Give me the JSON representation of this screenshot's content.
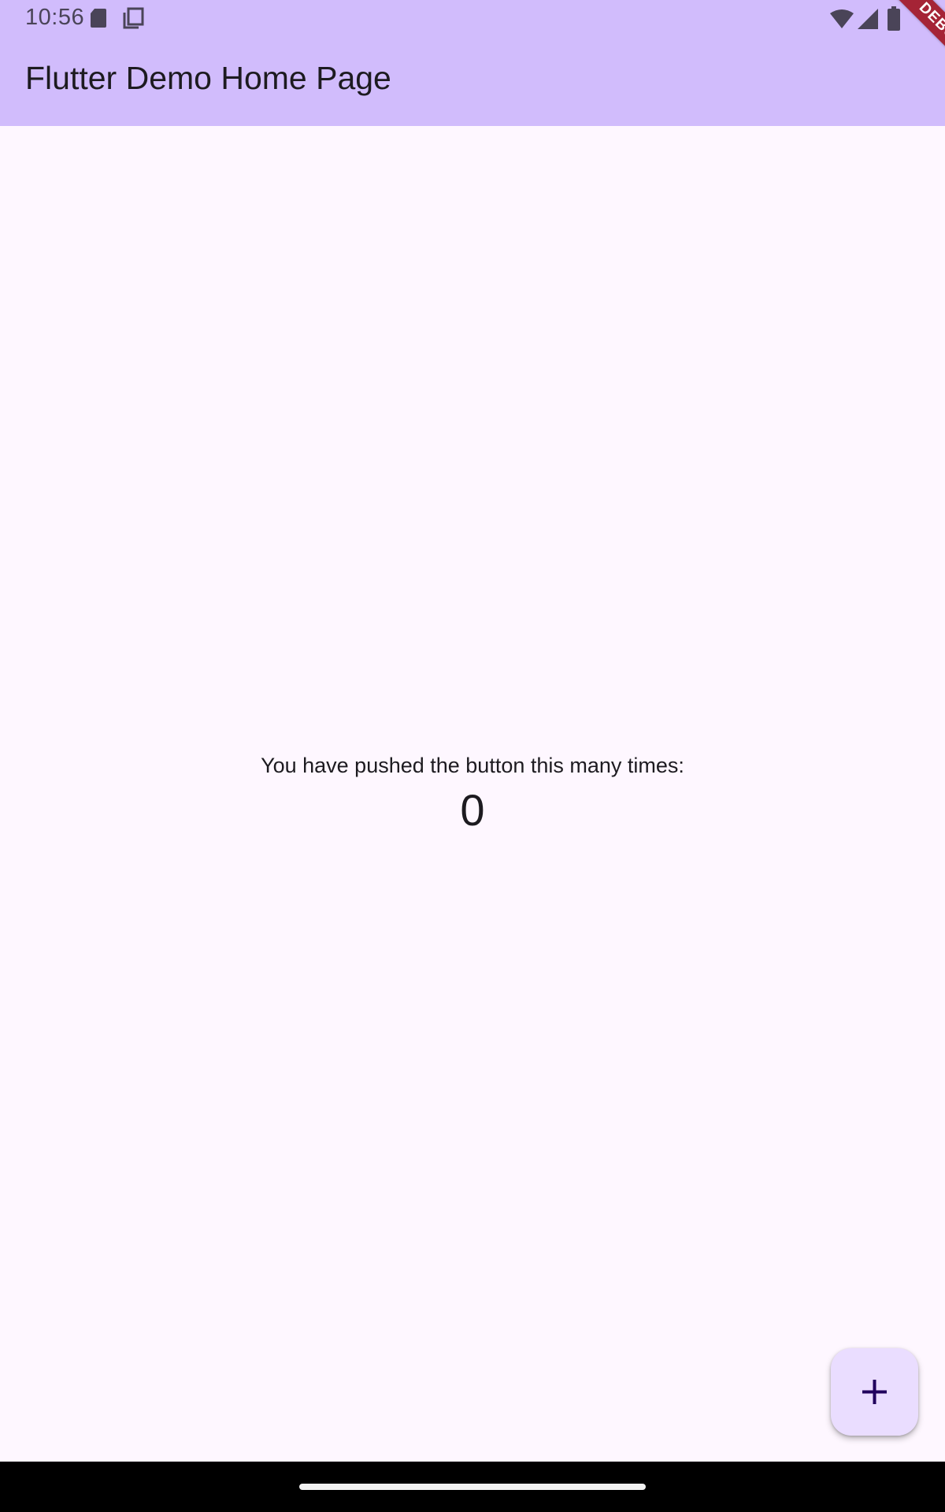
{
  "status_bar": {
    "time": "10:56",
    "icons": [
      "sd-card-icon",
      "copy-icon",
      "wifi-icon",
      "cell-signal-icon",
      "battery-icon"
    ]
  },
  "app_bar": {
    "title": "Flutter Demo Home Page",
    "background": "#d1bcfc"
  },
  "debug_banner": {
    "label": "DEBUG",
    "color": "#a52436"
  },
  "body": {
    "counter_label": "You have pushed the button this many times:",
    "counter_value": "0",
    "background": "#fef7ff"
  },
  "fab": {
    "icon": "plus-icon",
    "background": "#eaddff"
  },
  "nav_bar": {
    "gesture": "home-handle"
  }
}
